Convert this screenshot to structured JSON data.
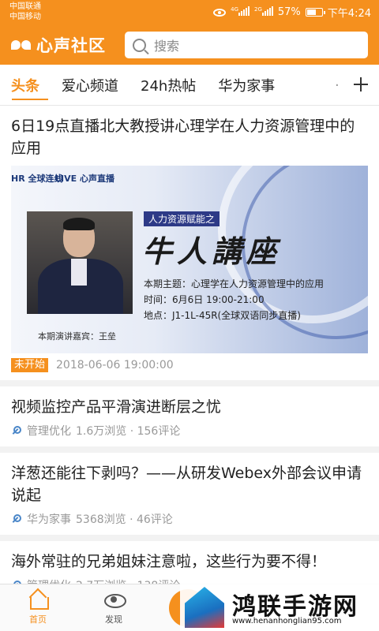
{
  "status_bar": {
    "carrier1": "中国联通",
    "carrier2": "中国移动",
    "net1": "4G",
    "net2": "2G",
    "battery": "57%",
    "time": "下午4:24"
  },
  "app_bar": {
    "app_name": "心声社区",
    "search_placeholder": "搜索"
  },
  "tabs": [
    {
      "label": "头条",
      "active": true
    },
    {
      "label": "爱心频道",
      "active": false
    },
    {
      "label": "24h热帖",
      "active": false
    },
    {
      "label": "华为家事",
      "active": false
    }
  ],
  "articles": [
    {
      "title": "6日19点直播北大教授讲心理学在人力资源管理中的应用",
      "banner": {
        "logo_hr": "HR 全球连线",
        "logo_live": "LIVE 心声直播",
        "tag": "人力资源赋能之",
        "big_title": "牛人講座",
        "topic": "本期主题：心理学在人力资源管理中的应用",
        "time": "时间：6月6日 19:00-21:00",
        "place": "地点：J1-1L-45R(全球双语同步直播)",
        "caption": "本期演讲嘉宾：王垒"
      },
      "badge": "未开始",
      "datetime": "2018-06-06 19:00:00"
    },
    {
      "title": "视频监控产品平滑演进断层之忧",
      "category": "管理优化",
      "stats": "1.6万浏览 · 156评论"
    },
    {
      "title": "洋葱还能往下剥吗？——从研发Webex外部会议申请说起",
      "category": "华为家事",
      "stats": "5368浏览 · 46评论"
    },
    {
      "title": "海外常驻的兄弟姐妹注意啦，这些行为要不得！",
      "category": "管理优化",
      "stats": "2.7万浏览 · 138评论"
    }
  ],
  "bottom_nav": {
    "home": "首页",
    "discover": "发现"
  },
  "watermark": {
    "text": "鸿联手游网",
    "url": "www.henanhonglian95.com"
  },
  "colors": {
    "brand": "#f5901e",
    "link_icon": "#4a86c8"
  }
}
